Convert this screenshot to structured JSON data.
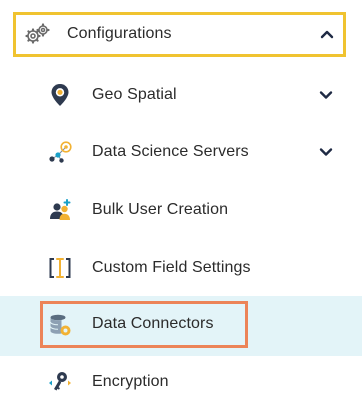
{
  "menu": {
    "parent": {
      "label": "Configurations",
      "icon": "gears-icon",
      "expanded": true,
      "highlight_color": "#f0c330"
    },
    "items": [
      {
        "label": "Geo Spatial",
        "icon": "map-pin-icon",
        "has_submenu": true
      },
      {
        "label": "Data Science Servers",
        "icon": "network-nodes-icon",
        "has_submenu": true
      },
      {
        "label": "Bulk User Creation",
        "icon": "users-add-icon",
        "has_submenu": false
      },
      {
        "label": "Custom Field Settings",
        "icon": "text-cursor-brackets-icon",
        "has_submenu": false
      },
      {
        "label": "Data Connectors",
        "icon": "database-gear-icon",
        "has_submenu": false,
        "selected": true,
        "highlight_color": "#ec8458",
        "selected_bg": "#e3f4f8"
      },
      {
        "label": "Encryption",
        "icon": "key-arrows-icon",
        "has_submenu": false
      }
    ]
  }
}
